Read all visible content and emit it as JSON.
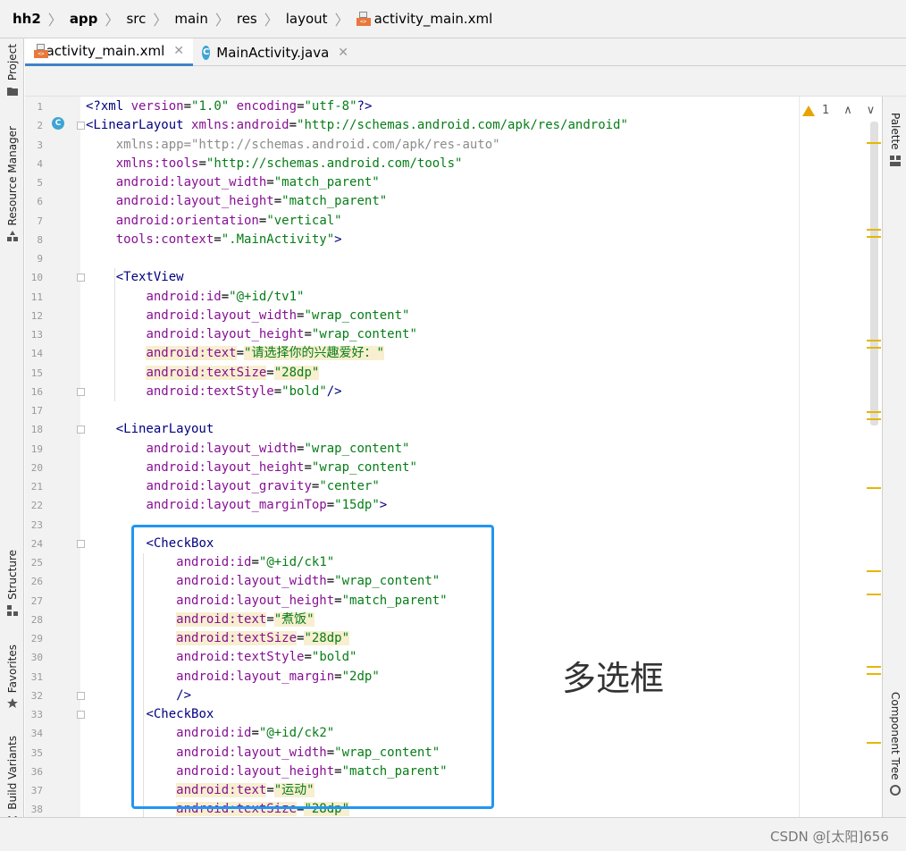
{
  "breadcrumb": {
    "items": [
      {
        "label": "hh2",
        "bold": true
      },
      {
        "label": "app",
        "bold": true
      },
      {
        "label": "src",
        "bold": false
      },
      {
        "label": "main",
        "bold": false
      },
      {
        "label": "res",
        "bold": false
      },
      {
        "label": "layout",
        "bold": false
      },
      {
        "label": "activity_main.xml",
        "bold": false,
        "icon": "xml-file-icon"
      }
    ]
  },
  "left_tools": {
    "project": "Project",
    "resource_manager": "Resource Manager",
    "structure": "Structure",
    "favorites": "Favorites",
    "build_variants": "Build Variants"
  },
  "right_tools": {
    "palette": "Palette",
    "component_tree": "Component Tree"
  },
  "tabs": [
    {
      "label": "activity_main.xml",
      "active": true,
      "icon": "xml-file-icon"
    },
    {
      "label": "MainActivity.java",
      "active": false,
      "icon": "java-class-icon"
    }
  ],
  "inspection": {
    "warning_count": "1"
  },
  "annotation": {
    "label": "多选框"
  },
  "watermark": "CSDN @[太阳]656",
  "colors": {
    "accent": "#4083c9",
    "selection_box": "#2196f3",
    "warning": "#e5a500"
  },
  "code": [
    {
      "n": "1",
      "segs": [
        [
          "pi",
          "<?xml "
        ],
        [
          "an",
          "version"
        ],
        [
          "p",
          "="
        ],
        [
          "av",
          "\"1.0\""
        ],
        [
          "p",
          " "
        ],
        [
          "an",
          "encoding"
        ],
        [
          "p",
          "="
        ],
        [
          "av",
          "\"utf-8\""
        ],
        [
          "pi",
          "?>"
        ]
      ]
    },
    {
      "n": "2",
      "segs": [
        [
          "tag",
          "<LinearLayout "
        ],
        [
          "an",
          "xmlns:"
        ],
        [
          "as",
          "android"
        ],
        [
          "p",
          "="
        ],
        [
          "av",
          "\"http://schemas.android.com/apk/res/android\""
        ]
      ]
    },
    {
      "n": "3",
      "segs": [
        [
          "p",
          "    "
        ],
        [
          "dim",
          "xmlns:app=\"http://schemas.android.com/apk/res-auto\""
        ]
      ]
    },
    {
      "n": "4",
      "segs": [
        [
          "p",
          "    "
        ],
        [
          "an",
          "xmlns:"
        ],
        [
          "as",
          "tools"
        ],
        [
          "p",
          "="
        ],
        [
          "av",
          "\"http://schemas.android.com/tools\""
        ]
      ]
    },
    {
      "n": "5",
      "segs": [
        [
          "p",
          "    "
        ],
        [
          "an",
          "android:layout_width"
        ],
        [
          "p",
          "="
        ],
        [
          "av",
          "\"match_parent\""
        ]
      ]
    },
    {
      "n": "6",
      "segs": [
        [
          "p",
          "    "
        ],
        [
          "an",
          "android:layout_height"
        ],
        [
          "p",
          "="
        ],
        [
          "av",
          "\"match_parent\""
        ]
      ]
    },
    {
      "n": "7",
      "segs": [
        [
          "p",
          "    "
        ],
        [
          "an",
          "android:orientation"
        ],
        [
          "p",
          "="
        ],
        [
          "av",
          "\"vertical\""
        ]
      ]
    },
    {
      "n": "8",
      "segs": [
        [
          "p",
          "    "
        ],
        [
          "an",
          "tools:context"
        ],
        [
          "p",
          "="
        ],
        [
          "av",
          "\".MainActivity\""
        ],
        [
          "tag",
          ">"
        ]
      ]
    },
    {
      "n": "9",
      "segs": []
    },
    {
      "n": "10",
      "segs": [
        [
          "p",
          "    "
        ],
        [
          "tag",
          "<TextView"
        ]
      ]
    },
    {
      "n": "11",
      "segs": [
        [
          "p",
          "        "
        ],
        [
          "an",
          "android:id"
        ],
        [
          "p",
          "="
        ],
        [
          "av",
          "\"@+id/tv1\""
        ]
      ]
    },
    {
      "n": "12",
      "segs": [
        [
          "p",
          "        "
        ],
        [
          "an",
          "android:layout_width"
        ],
        [
          "p",
          "="
        ],
        [
          "av",
          "\"wrap_content\""
        ]
      ]
    },
    {
      "n": "13",
      "segs": [
        [
          "p",
          "        "
        ],
        [
          "an",
          "android:layout_height"
        ],
        [
          "p",
          "="
        ],
        [
          "av",
          "\"wrap_content\""
        ]
      ]
    },
    {
      "n": "14",
      "hl": true,
      "segs": [
        [
          "p",
          "        "
        ],
        [
          "an",
          "android:text"
        ],
        [
          "p",
          "="
        ],
        [
          "av",
          "\"请选择你的兴趣爱好：\""
        ]
      ]
    },
    {
      "n": "15",
      "hl": true,
      "segs": [
        [
          "p",
          "        "
        ],
        [
          "an",
          "android:textSize"
        ],
        [
          "p",
          "="
        ],
        [
          "av",
          "\"28dp\""
        ]
      ]
    },
    {
      "n": "16",
      "segs": [
        [
          "p",
          "        "
        ],
        [
          "an",
          "android:textStyle"
        ],
        [
          "p",
          "="
        ],
        [
          "av",
          "\"bold\""
        ],
        [
          "tag",
          "/>"
        ]
      ]
    },
    {
      "n": "17",
      "segs": []
    },
    {
      "n": "18",
      "segs": [
        [
          "p",
          "    "
        ],
        [
          "tag",
          "<LinearLayout"
        ]
      ]
    },
    {
      "n": "19",
      "segs": [
        [
          "p",
          "        "
        ],
        [
          "an",
          "android:layout_width"
        ],
        [
          "p",
          "="
        ],
        [
          "av",
          "\"wrap_content\""
        ]
      ]
    },
    {
      "n": "20",
      "segs": [
        [
          "p",
          "        "
        ],
        [
          "an",
          "android:layout_height"
        ],
        [
          "p",
          "="
        ],
        [
          "av",
          "\"wrap_content\""
        ]
      ]
    },
    {
      "n": "21",
      "segs": [
        [
          "p",
          "        "
        ],
        [
          "an",
          "android:layout_gravity"
        ],
        [
          "p",
          "="
        ],
        [
          "av",
          "\"center\""
        ]
      ]
    },
    {
      "n": "22",
      "segs": [
        [
          "p",
          "        "
        ],
        [
          "an",
          "android:layout_marginTop"
        ],
        [
          "p",
          "="
        ],
        [
          "av",
          "\"15dp\""
        ],
        [
          "tag",
          ">"
        ]
      ]
    },
    {
      "n": "23",
      "segs": []
    },
    {
      "n": "24",
      "segs": [
        [
          "p",
          "        "
        ],
        [
          "tag",
          "<CheckBox"
        ]
      ]
    },
    {
      "n": "25",
      "segs": [
        [
          "p",
          "            "
        ],
        [
          "an",
          "android:id"
        ],
        [
          "p",
          "="
        ],
        [
          "av",
          "\"@+id/ck1\""
        ]
      ]
    },
    {
      "n": "26",
      "segs": [
        [
          "p",
          "            "
        ],
        [
          "an",
          "android:layout_width"
        ],
        [
          "p",
          "="
        ],
        [
          "av",
          "\"wrap_content\""
        ]
      ]
    },
    {
      "n": "27",
      "segs": [
        [
          "p",
          "            "
        ],
        [
          "an",
          "android:layout_height"
        ],
        [
          "p",
          "="
        ],
        [
          "av",
          "\"match_parent\""
        ]
      ]
    },
    {
      "n": "28",
      "hl": true,
      "segs": [
        [
          "p",
          "            "
        ],
        [
          "an",
          "android:text"
        ],
        [
          "p",
          "="
        ],
        [
          "av",
          "\"煮饭\""
        ]
      ]
    },
    {
      "n": "29",
      "hl": true,
      "segs": [
        [
          "p",
          "            "
        ],
        [
          "an",
          "android:textSize"
        ],
        [
          "p",
          "="
        ],
        [
          "av",
          "\"28dp\""
        ]
      ]
    },
    {
      "n": "30",
      "segs": [
        [
          "p",
          "            "
        ],
        [
          "an",
          "android:textStyle"
        ],
        [
          "p",
          "="
        ],
        [
          "av",
          "\"bold\""
        ]
      ]
    },
    {
      "n": "31",
      "segs": [
        [
          "p",
          "            "
        ],
        [
          "an",
          "android:layout_margin"
        ],
        [
          "p",
          "="
        ],
        [
          "av",
          "\"2dp\""
        ]
      ]
    },
    {
      "n": "32",
      "segs": [
        [
          "p",
          "            "
        ],
        [
          "tag",
          "/>"
        ]
      ]
    },
    {
      "n": "33",
      "segs": [
        [
          "p",
          "        "
        ],
        [
          "tag",
          "<CheckBox"
        ]
      ]
    },
    {
      "n": "34",
      "segs": [
        [
          "p",
          "            "
        ],
        [
          "an",
          "android:id"
        ],
        [
          "p",
          "="
        ],
        [
          "av",
          "\"@+id/ck2\""
        ]
      ]
    },
    {
      "n": "35",
      "segs": [
        [
          "p",
          "            "
        ],
        [
          "an",
          "android:layout_width"
        ],
        [
          "p",
          "="
        ],
        [
          "av",
          "\"wrap_content\""
        ]
      ]
    },
    {
      "n": "36",
      "segs": [
        [
          "p",
          "            "
        ],
        [
          "an",
          "android:layout_height"
        ],
        [
          "p",
          "="
        ],
        [
          "av",
          "\"match_parent\""
        ]
      ]
    },
    {
      "n": "37",
      "hl": true,
      "segs": [
        [
          "p",
          "            "
        ],
        [
          "an",
          "android:text"
        ],
        [
          "p",
          "="
        ],
        [
          "av",
          "\"运动\""
        ]
      ]
    },
    {
      "n": "38",
      "hl": true,
      "segs": [
        [
          "p",
          "            "
        ],
        [
          "an",
          "android:textSize"
        ],
        [
          "p",
          "="
        ],
        [
          "av",
          "\"28dp\""
        ]
      ]
    }
  ]
}
